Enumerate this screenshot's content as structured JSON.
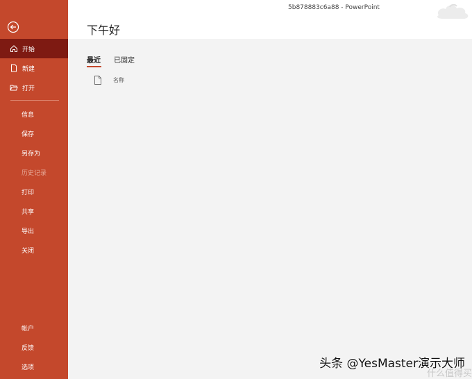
{
  "window": {
    "title": "5b878883c6a88  -  PowerPoint"
  },
  "sidebar": {
    "back_icon": "back-arrow-icon",
    "items": [
      {
        "label": "开始",
        "icon": "home-icon",
        "active": true
      },
      {
        "label": "新建",
        "icon": "new-file-icon"
      },
      {
        "label": "打开",
        "icon": "open-folder-icon"
      },
      {
        "label": "信息"
      },
      {
        "label": "保存"
      },
      {
        "label": "另存为"
      },
      {
        "label": "历史记录",
        "disabled": true
      },
      {
        "label": "打印"
      },
      {
        "label": "共享"
      },
      {
        "label": "导出"
      },
      {
        "label": "关闭"
      },
      {
        "label": "帐户"
      },
      {
        "label": "反馈"
      },
      {
        "label": "选项"
      }
    ]
  },
  "main": {
    "greeting": "下午好",
    "tabs": [
      {
        "label": "最近",
        "active": true
      },
      {
        "label": "已固定"
      }
    ],
    "list_header": {
      "name_col": "名称"
    }
  },
  "watermark": {
    "text": "头条 @YesMaster演示大师",
    "sub": "什么值得买"
  },
  "colors": {
    "sidebar": "#c4482c",
    "sidebar_active": "#7e1a12",
    "background": "#f3f3f3"
  }
}
